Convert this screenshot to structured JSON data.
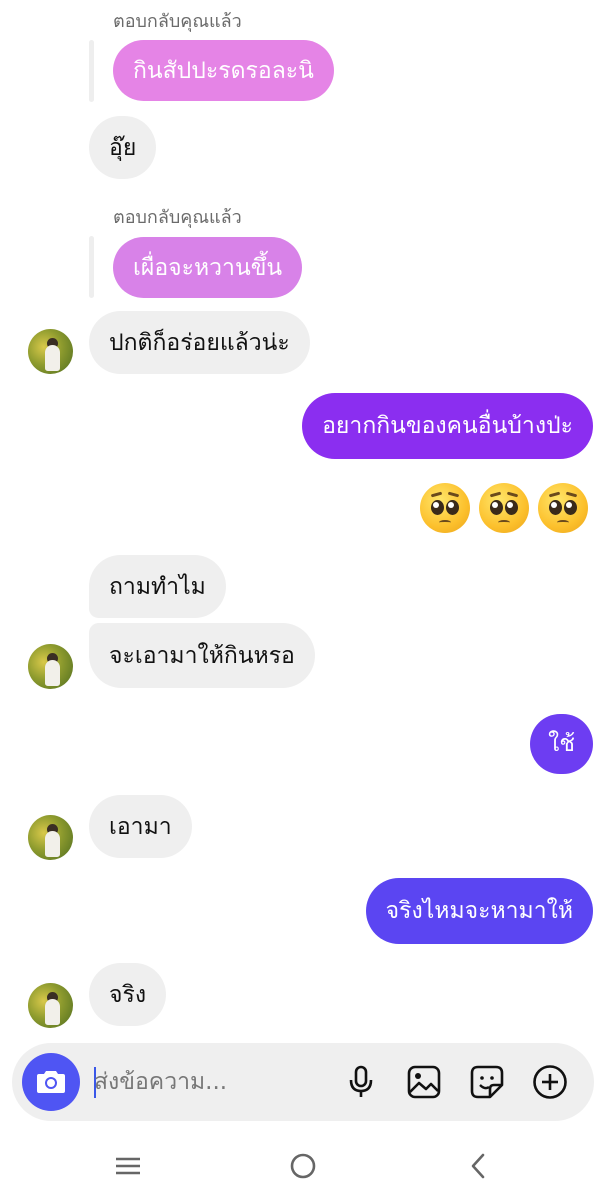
{
  "colors": {
    "incoming_bubble": "#efefef",
    "quoted_bubble_1": "#e584e6",
    "quoted_bubble_2": "#d882e8",
    "outgoing_purple": "#8b2ef0",
    "outgoing_violet": "#6d3df2",
    "outgoing_indigo": "#5b45f2",
    "camera_button": "#4f55f3"
  },
  "chat": {
    "reply_label_1": "ตอบกลับคุณแล้ว",
    "quoted_1": "กินสัปปะรดรอละนิ",
    "msg_1": "อุ๊ย",
    "reply_label_2": "ตอบกลับคุณแล้ว",
    "quoted_2": "เผื่อจะหวานขึ้น",
    "msg_2": "ปกติก็อร่อยแล้วน่ะ",
    "out_1": "อยากกินของคนอื่นบ้างป่ะ",
    "emoji_reaction": "pleading-face x3",
    "msg_3": "ถามทำไม",
    "msg_4": "จะเอามาให้กินหรอ",
    "out_2": "ใช้",
    "msg_5": "เอามา",
    "out_3": "จริงไหมจะหามาให้",
    "msg_6": "จริง"
  },
  "composer": {
    "placeholder": "ส่งข้อความ...",
    "icons": [
      "camera-icon",
      "microphone-icon",
      "gallery-icon",
      "sticker-icon",
      "plus-icon"
    ]
  },
  "navbar": {
    "icons": [
      "recent-apps-icon",
      "home-icon",
      "back-icon"
    ]
  }
}
